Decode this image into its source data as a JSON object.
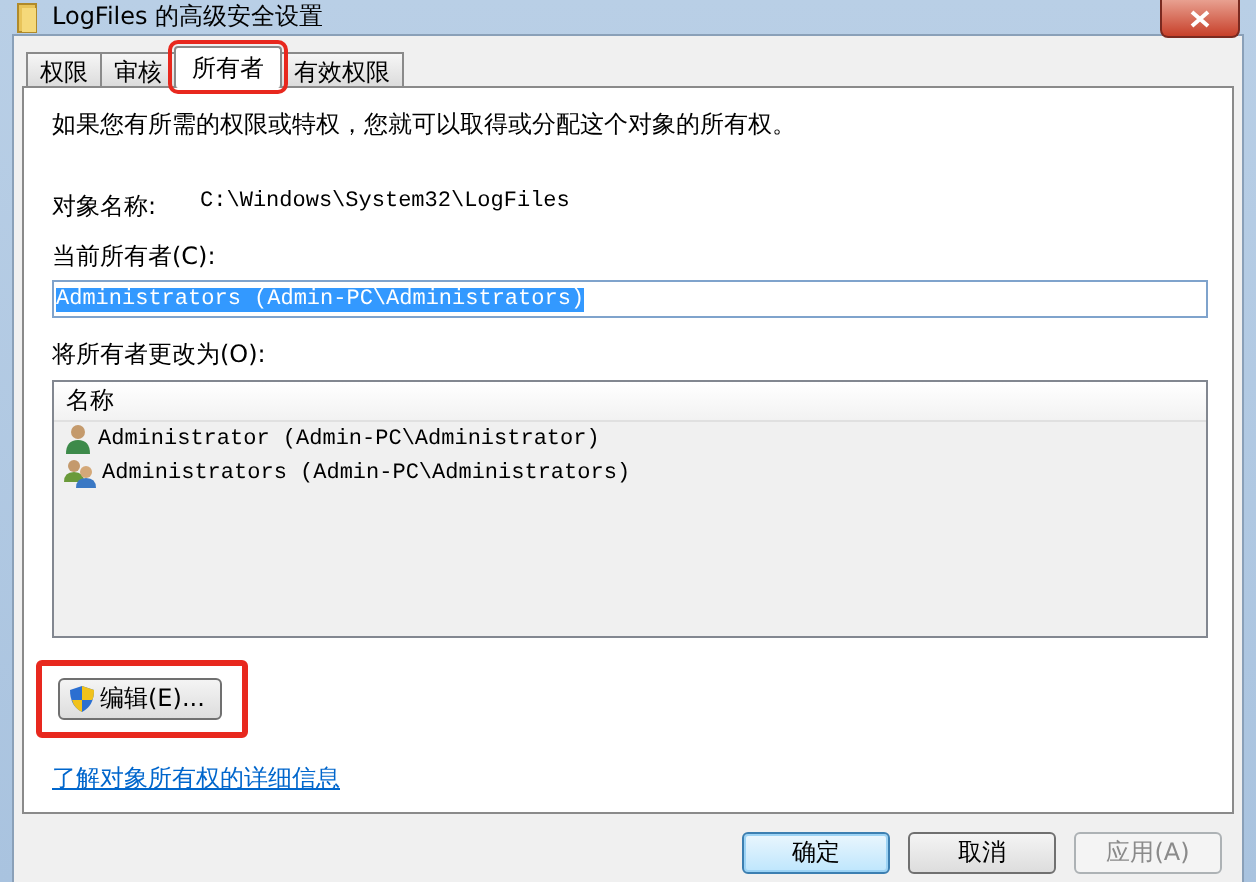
{
  "window": {
    "title": "LogFiles 的高级安全设置"
  },
  "tabs": [
    {
      "label": "权限",
      "selected": false,
      "highlighted": false
    },
    {
      "label": "审核",
      "selected": false,
      "highlighted": false
    },
    {
      "label": "所有者",
      "selected": true,
      "highlighted": true
    },
    {
      "label": "有效权限",
      "selected": false,
      "highlighted": false
    }
  ],
  "intro": "如果您有所需的权限或特权，您就可以取得或分配这个对象的所有权。",
  "object_name": {
    "label": "对象名称:",
    "value": "C:\\Windows\\System32\\LogFiles"
  },
  "current_owner": {
    "label": "当前所有者(C):",
    "value": "Administrators (Admin-PC\\Administrators)",
    "value_selected": true
  },
  "change_owner": {
    "label": "将所有者更改为(O):",
    "columns": [
      "名称"
    ],
    "rows": [
      {
        "name": "Administrator (Admin-PC\\Administrator)",
        "kind": "user",
        "selected": false
      },
      {
        "name": "Administrators (Admin-PC\\Administrators)",
        "kind": "group",
        "selected": false
      }
    ]
  },
  "edit_button": {
    "label": "编辑(E)...",
    "highlighted": true
  },
  "link": "了解对象所有权的详细信息",
  "buttons": [
    {
      "label": "确定",
      "disabled": false,
      "default": true
    },
    {
      "label": "取消",
      "disabled": false,
      "default": false
    },
    {
      "label": "应用(A)",
      "disabled": true,
      "default": false
    }
  ]
}
